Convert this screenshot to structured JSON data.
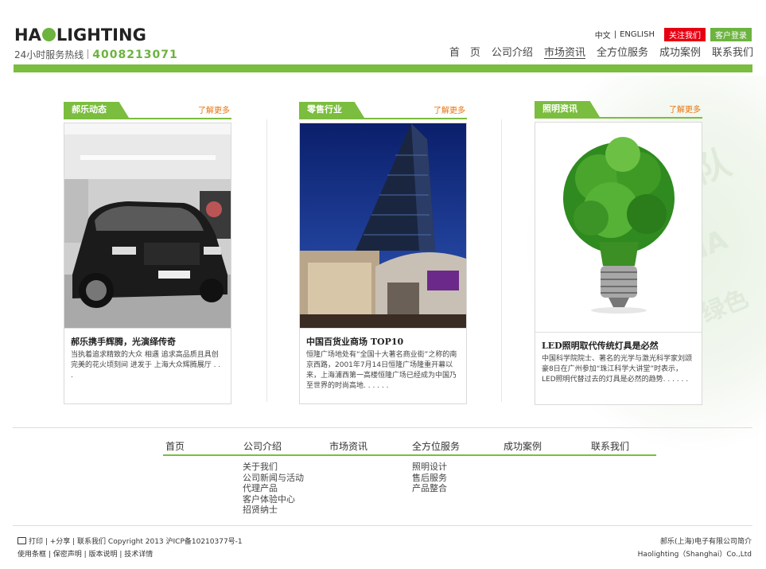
{
  "brand": {
    "logo": "HAOLIGHTING",
    "hotline_label": "24小时服务热线",
    "hotline_number": "4008213071"
  },
  "toplinks": {
    "zh": "中文",
    "en": "ENGLISH",
    "follow": "关注我们",
    "login": "客户登录"
  },
  "nav": [
    {
      "label": "首　页"
    },
    {
      "label": "公司介绍"
    },
    {
      "label": "市场资讯",
      "active": true
    },
    {
      "label": "全方位服务"
    },
    {
      "label": "成功案例"
    },
    {
      "label": "联系我们"
    }
  ],
  "columns": [
    {
      "tab": "郝乐动态",
      "more": "了解更多",
      "title": "郝乐携手辉腾，光演绎传奇",
      "desc": "当执着追求精致的大众 相遇 追求高品质且具创完美的花火顷刻间 进发于 上海大众辉腾展厅 . . ."
    },
    {
      "tab": "零售行业",
      "more": "了解更多",
      "title": "中国百货业商场 TOP10",
      "desc": "恒隆广场地处有“全国十大著名商业街”之称的南京西路，2001年7月14日恒隆广场隆重开幕以来，上海浦西第一高楼恒隆广场已经成为中国乃至世界的时尚高地. . .  . . ."
    },
    {
      "tab": "照明资讯",
      "more": "了解更多",
      "title": "LED照明取代传统灯具是必然",
      "desc": "中国科学院院士、著名的光学与激光科学家刘颂豪8日在广州参加“珠江科学大讲堂”时表示，LED照明代替过去的灯具是必然的趋势. . .  . . ."
    }
  ],
  "footer": {
    "nav": [
      "首页",
      "公司介绍",
      "市场资讯",
      "全方位服务",
      "成功案例",
      "联系我们"
    ],
    "company_links": [
      "关于我们",
      "公司新闻与活动",
      "代理产品",
      "客户体验中心",
      "招贤纳士"
    ],
    "service_links": [
      "照明设计",
      "售后服务",
      "产品整合"
    ],
    "bottom_line1": "打印 | +分享 | 联系我们 Copyright 2013 沪ICP备10210377号-1",
    "bottom_line2": "使用条框 | 保密声明 | 版本说明 | 技术详情",
    "company_cn": "郝乐(上海)电子有限公司简介",
    "company_en": "Haolighting（Shanghai）Co.,Ltd"
  }
}
